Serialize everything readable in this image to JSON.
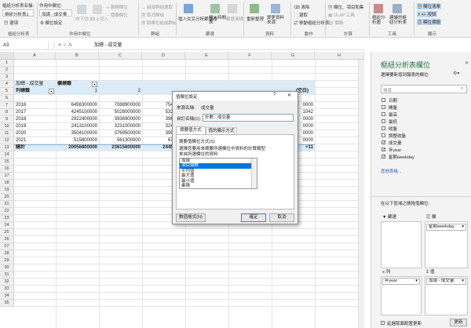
{
  "ribbon": {
    "pivot_name_label": "樞紐分析表名稱:",
    "pivot_name_value": "樞紐分析表1",
    "options_label": "選項",
    "active_field_label": "作用中欄位:",
    "active_field_value": "加總 - 成交量",
    "field_settings_label": "欄位設定",
    "drill_down_label": "向下切入",
    "drill_up_label": "向上切入",
    "expand_field_label": "展開欄位",
    "collapse_field_label": "摺疊欄位",
    "group_selection_label": "組成群組選取",
    "ungroup_label": "取消群組",
    "group_field_label": "將欄位組成群組",
    "insert_slicer_label": "插入交叉分析篩選器",
    "insert_timeline_label": "插入時間表",
    "filter_connections_label": "篩選連線",
    "refresh_label": "重新整理",
    "change_source_label": "變更資料來源",
    "clear_label": "清除",
    "select_label": "選取",
    "move_pivot_label": "移動樞紐分析表",
    "fields_items_sets_label": "欄位、項目和集",
    "olap_tools_label": "OLAP 工具",
    "relationships_label": "關聯",
    "pivotchart_label": "樞紐分析圖",
    "recommended_label": "建議的樞紐分析表",
    "field_list_label": "欄位清單",
    "plus_minus_label": "+/- 按鈕",
    "field_headers_label": "欄位標題",
    "groups": [
      "樞紐分析表",
      "作用中欄位",
      "群組",
      "篩選",
      "資料",
      "動作",
      "計算",
      "工具",
      "顯示"
    ]
  },
  "formula_bar": {
    "name_box": "A3",
    "content": "加總 - 成交量"
  },
  "sheet": {
    "columns": [
      "A",
      "B",
      "C",
      "D",
      "E",
      "F",
      "G",
      "H"
    ],
    "rows": [
      "1",
      "2",
      "3",
      "4",
      "5",
      "6",
      "7",
      "8",
      "9",
      "10",
      "11",
      "12",
      "13",
      "14",
      "15",
      "16",
      "17",
      "18",
      "19",
      "20",
      "21",
      "22",
      "23",
      "24",
      "25",
      "26",
      "27",
      "28",
      "29",
      "30",
      "31",
      "32",
      "33",
      "34",
      "35"
    ],
    "pivot_title": "加總 - 成交量",
    "col_labels_header": "欄標籤",
    "row_labels_header": "列標籤",
    "col_values": [
      "1",
      "2"
    ],
    "data_rows": [
      {
        "label": "2016",
        "b": "6456300000",
        "c": "7088900000",
        "d": "7547800",
        "g": "0000"
      },
      {
        "label": "2017",
        "b": "4245100000",
        "c": "5028000000",
        "d": "5329300",
        "g": "1042"
      },
      {
        "label": "2018",
        "b": "2922400000",
        "c": "3936900000",
        "d": "3965500",
        "g": "0000"
      },
      {
        "label": "2019",
        "b": "2413100000",
        "c": "3231000000",
        "d": "3241300",
        "g": "0000"
      },
      {
        "label": "2020",
        "b": "3504100000",
        "c": "3769500000",
        "d": "3904400",
        "g": "0000"
      },
      {
        "label": "2021",
        "b": "515800000",
        "c": "561300000",
        "d": "670400",
        "g": "0000"
      }
    ],
    "total_row": {
      "label": "總計",
      "b": "20056800000",
      "c": "23615600000",
      "d": "24458700",
      "g": "+11"
    },
    "partial_header_g": "(空白)"
  },
  "dialog": {
    "title": "值欄位設定",
    "help": "?",
    "close": "✕",
    "source_label": "來源名稱:",
    "source_value": "成交量",
    "custom_label": "自訂名稱(C):",
    "custom_value": "計數 - 成交量",
    "tab_summarize": "摘要值方式",
    "tab_show": "值的顯示方式",
    "summarize_by_label": "摘要值欄位方式(S)",
    "instruction_1": "選擇您要用來摘要所選欄位中資料的",
    "instruction_2": "計算類型",
    "instruction_3": "來自所選欄位的資料",
    "options": [
      "加總",
      "項目個數",
      "平均值",
      "最大值",
      "最小值",
      "乘積"
    ],
    "selected_index": 1,
    "number_format_btn": "數值格式(N)",
    "ok_btn": "確定",
    "cancel_btn": "取消"
  },
  "pane": {
    "title": "樞紐分析表欄位",
    "subtitle": "選擇要新增到報表的欄位:",
    "search_placeholder": "搜尋",
    "fields": [
      {
        "label": "日期",
        "checked": false
      },
      {
        "label": "開盤",
        "checked": false
      },
      {
        "label": "最高",
        "checked": false
      },
      {
        "label": "最低",
        "checked": false
      },
      {
        "label": "收盤",
        "checked": false
      },
      {
        "label": "調整收盤",
        "checked": false
      },
      {
        "label": "成交量",
        "checked": true
      },
      {
        "label": "年year",
        "checked": true
      },
      {
        "label": "星期weekday",
        "checked": true
      }
    ],
    "more_tables": "其他表格...",
    "drag_hint": "在以下區域之間拖曳欄位:",
    "filter_label": "篩選",
    "columns_label": "欄",
    "rows_label": "列",
    "values_label": "值",
    "col_chip": "星期weekday",
    "row_chip": "年year",
    "value_chip": "加總 - 成交量",
    "defer_label": "延遲版面配置更新",
    "update_btn": "更新"
  }
}
